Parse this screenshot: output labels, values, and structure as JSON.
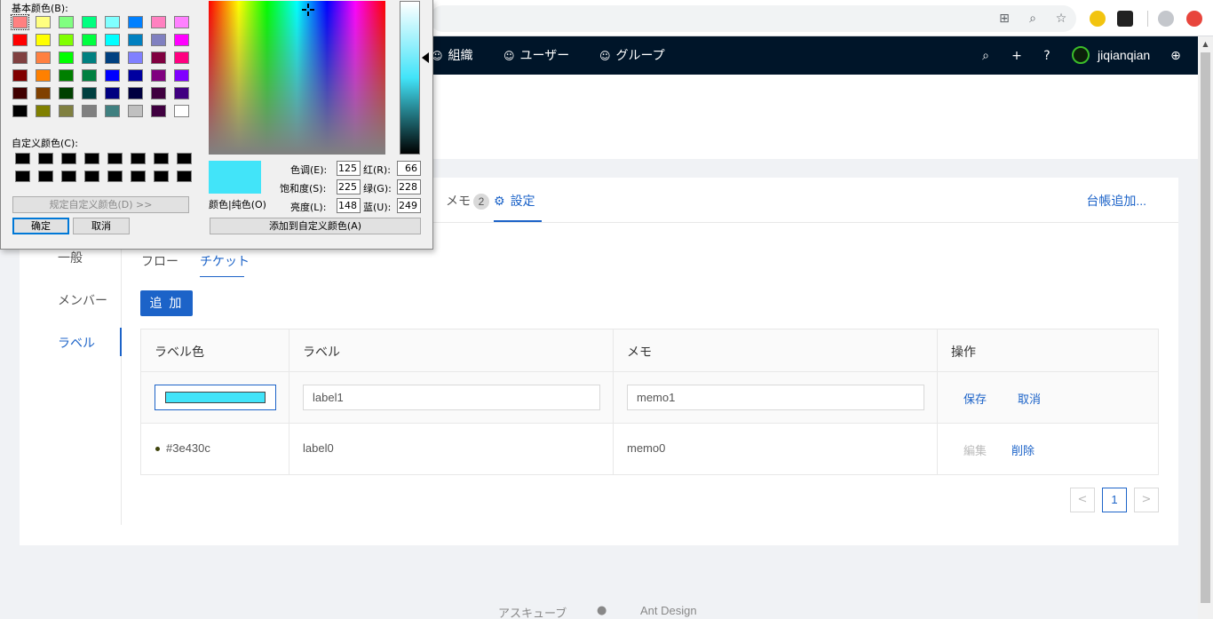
{
  "app_nav": {
    "org_label": "組織",
    "user_label": "ユーザー",
    "group_label": "グループ",
    "username": "jiqianqian"
  },
  "tabs": {
    "memo_label": "メモ",
    "memo_count": "2",
    "settings_label": "設定",
    "add_ledger": "台帳追加..."
  },
  "side_menu": [
    "一般",
    "メンバー",
    "ラベル"
  ],
  "subtabs": [
    "フロー",
    "チケット"
  ],
  "add_button": "追 加",
  "table": {
    "headers": [
      "ラベル色",
      "ラベル",
      "メモ",
      "操作"
    ],
    "edit_row": {
      "color": "#42e4f9",
      "label": "label1",
      "memo": "memo1",
      "save": "保存",
      "cancel": "取消"
    },
    "rows": [
      {
        "color": "#3e430c",
        "color_text": "#3e430c",
        "label": "label0",
        "memo": "memo0",
        "edit": "編集",
        "delete": "削除"
      }
    ]
  },
  "pagination": {
    "current": "1",
    "prev": "<",
    "next": ">"
  },
  "footer": {
    "left": "アスキューブ",
    "right": "Ant Design"
  },
  "color_dialog": {
    "basic_colors_label": "基本颜色(B):",
    "custom_colors_label": "自定义颜色(C):",
    "define_custom_button": "规定自定义颜色(D) >>",
    "ok_button": "确定",
    "cancel_button": "取消",
    "color_solid_label": "颜色|纯色(O)",
    "hue_label": "色调(E):",
    "sat_label": "饱和度(S):",
    "lum_label": "亮度(L):",
    "red_label": "红(R):",
    "green_label": "绿(G):",
    "blue_label": "蓝(U):",
    "hue": "125",
    "sat": "225",
    "lum": "148",
    "red": "66",
    "green": "228",
    "blue": "249",
    "add_custom_button": "添加到自定义颜色(A)",
    "selected_color": "#42e4f9",
    "basic_colors": [
      "#ff8080",
      "#ffff80",
      "#80ff80",
      "#00ff80",
      "#80ffff",
      "#0080ff",
      "#ff80c0",
      "#ff80ff",
      "#ff0000",
      "#ffff00",
      "#80ff00",
      "#00ff40",
      "#00ffff",
      "#0080c0",
      "#8080c0",
      "#ff00ff",
      "#804040",
      "#ff8040",
      "#00ff00",
      "#008080",
      "#004080",
      "#8080ff",
      "#800040",
      "#ff0080",
      "#800000",
      "#ff8000",
      "#008000",
      "#008040",
      "#0000ff",
      "#0000a0",
      "#800080",
      "#8000ff",
      "#400000",
      "#804000",
      "#004000",
      "#004040",
      "#000080",
      "#000040",
      "#400040",
      "#400080",
      "#000000",
      "#808000",
      "#808040",
      "#808080",
      "#408080",
      "#c0c0c0",
      "#400040",
      "#ffffff"
    ]
  }
}
